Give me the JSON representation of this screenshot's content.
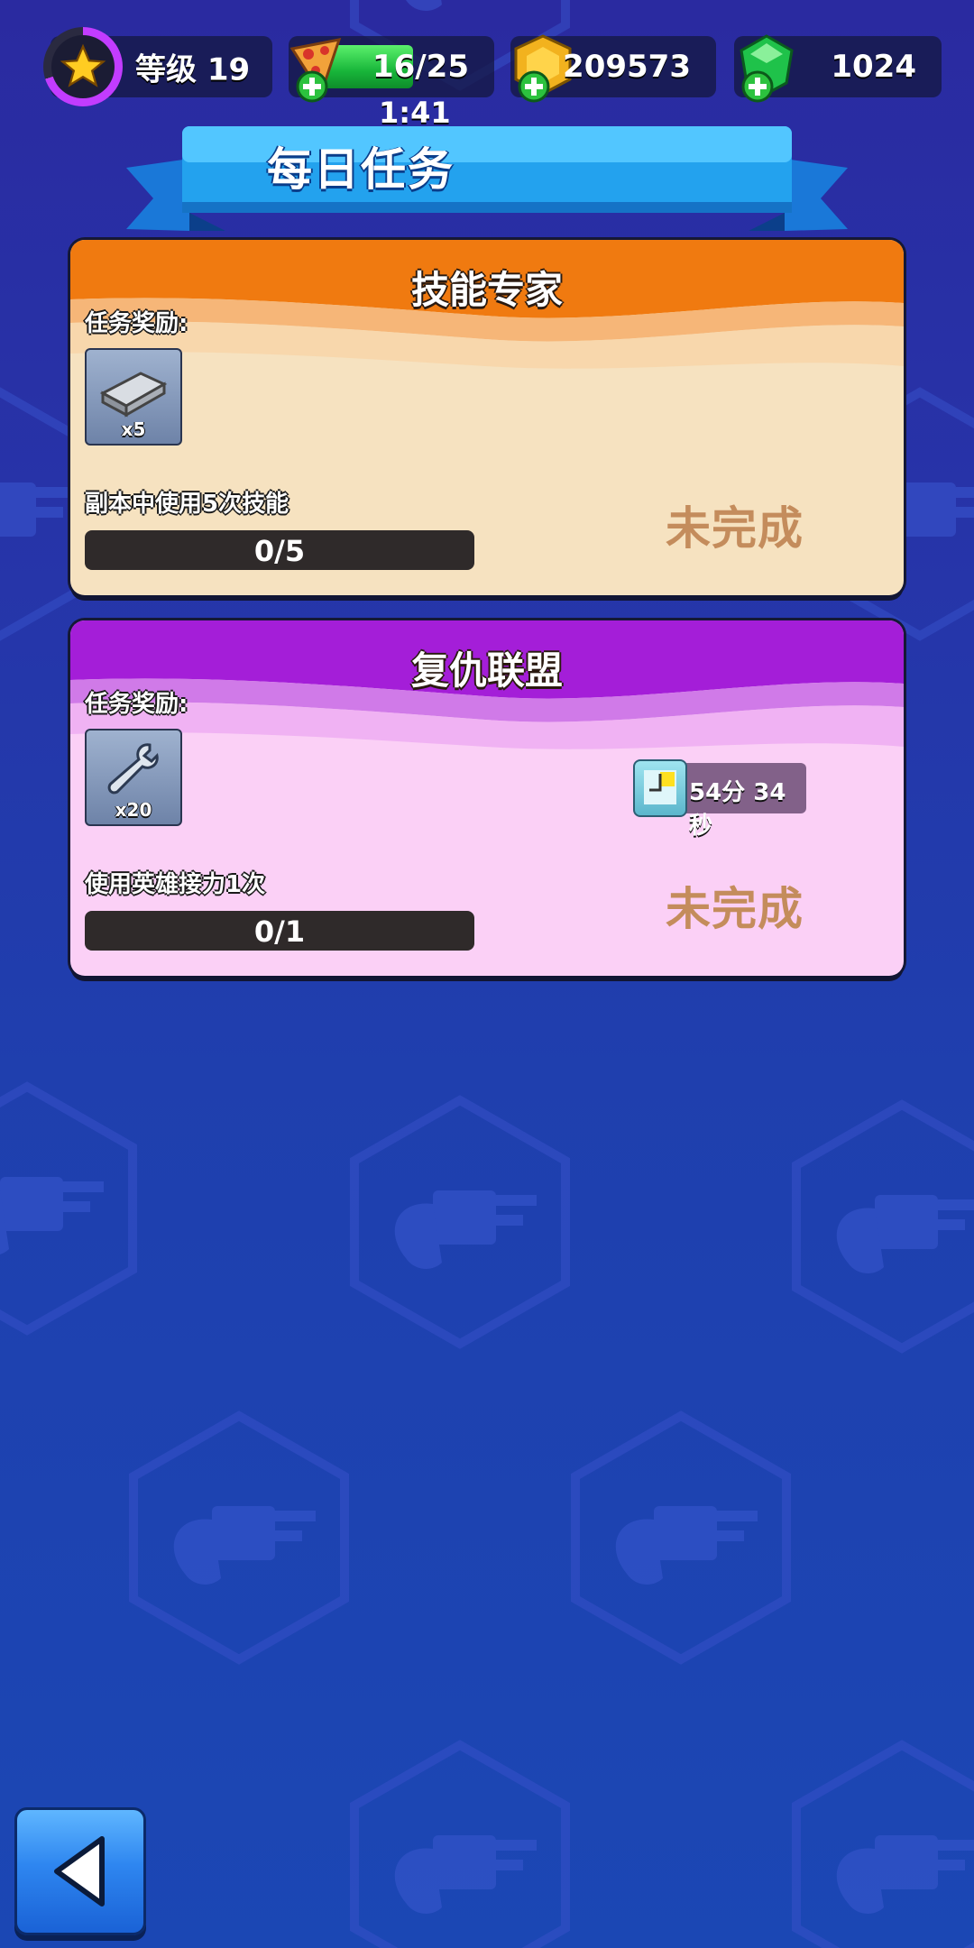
{
  "top_bar": {
    "level_label": "等级 19",
    "energy": "16/25",
    "energy_fill_fraction": 0.64,
    "energy_timer": "1:41",
    "gold": "209573",
    "gems": "1024"
  },
  "page_title": "每日任务",
  "tasks": [
    {
      "title": "技能专家",
      "reward_label": "任务奖励:",
      "reward_icon": "metal-bar-icon",
      "reward_qty": "x5",
      "description": "副本中使用5次技能",
      "progress_text": "0/5",
      "progress_fraction": 0.0,
      "status": "未完成"
    },
    {
      "title": "复仇联盟",
      "reward_label": "任务奖励:",
      "reward_icon": "wrench-icon",
      "reward_qty": "x20",
      "description": "使用英雄接力1次",
      "progress_text": "0/1",
      "progress_fraction": 0.0,
      "status": "未完成",
      "timer": "54分 34秒"
    }
  ],
  "colors": {
    "orange_header": "#f07a10",
    "purple_header": "#a41ed8",
    "status_text": "#c48c5c",
    "energy_green": "#18b63a"
  }
}
